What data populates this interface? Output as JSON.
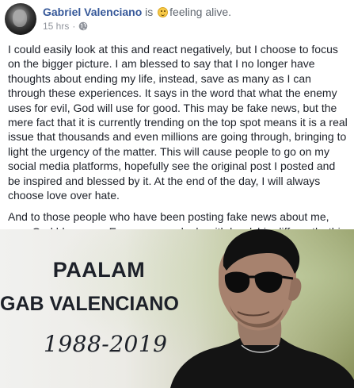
{
  "post": {
    "author_name": "Gabriel Valenciano",
    "is_text": " is ",
    "feeling_text": "feeling alive.",
    "timestamp": "15 hrs",
    "separator": "·",
    "paragraphs": [
      "I could easily look at this and react negatively, but I choose to focus on the bigger picture. I am blessed to say that I no longer have thoughts about ending my life, instead, save as many as I can through these experiences. It says in the word that what the enemy uses for evil, God will use for good. This may be fake news, but the mere fact that it is currently trending on the top spot means it is a real issue that thousands and even millions are going through, bringing to light the urgency of the matter. This will cause people to go on my social media platforms, hopefully see the original post I posted and be inspired and blessed by it. At the end of the day, I will always choose love over hate.",
      "And to those people who have been posting fake news about me, may God bless you. Every person deals with hardship differently, this could be your way of dealing with your pain. So with that I pray for you."
    ],
    "icons": {
      "avatar": "avatar-photo",
      "feeling": "smiley-emoji-icon",
      "privacy": "globe-icon"
    }
  },
  "photo": {
    "line1": "PAALAM",
    "line2": "GAB VALENCIANO",
    "line3": "1988-2019"
  }
}
